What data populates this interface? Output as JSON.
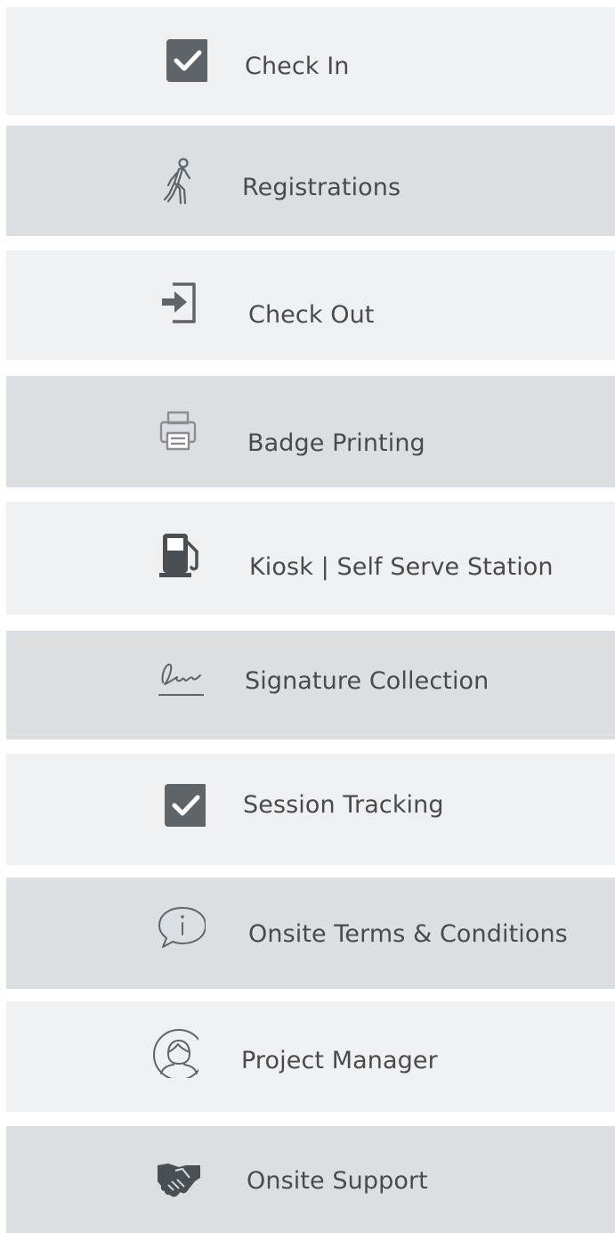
{
  "menu": {
    "items": [
      {
        "label": "Check In",
        "icon": "checkbox-checked-icon"
      },
      {
        "label": "Registrations",
        "icon": "walking-person-icon"
      },
      {
        "label": "Check Out",
        "icon": "exit-arrow-icon"
      },
      {
        "label": "Badge Printing",
        "icon": "printer-icon"
      },
      {
        "label": "Kiosk | Self Serve Station",
        "icon": "fuel-pump-icon"
      },
      {
        "label": "Signature Collection",
        "icon": "signature-icon"
      },
      {
        "label": "Session Tracking",
        "icon": "checkbox-checked-icon"
      },
      {
        "label": "Onsite Terms & Conditions",
        "icon": "info-speech-bubble-icon"
      },
      {
        "label": "Project Manager",
        "icon": "person-circle-icon"
      },
      {
        "label": "Onsite Support",
        "icon": "handshake-icon"
      }
    ]
  },
  "colors": {
    "row_light": "#eff0f1",
    "row_dark": "#dcdfe2",
    "icon": "#5f6468",
    "text": "#4a4a4c"
  }
}
